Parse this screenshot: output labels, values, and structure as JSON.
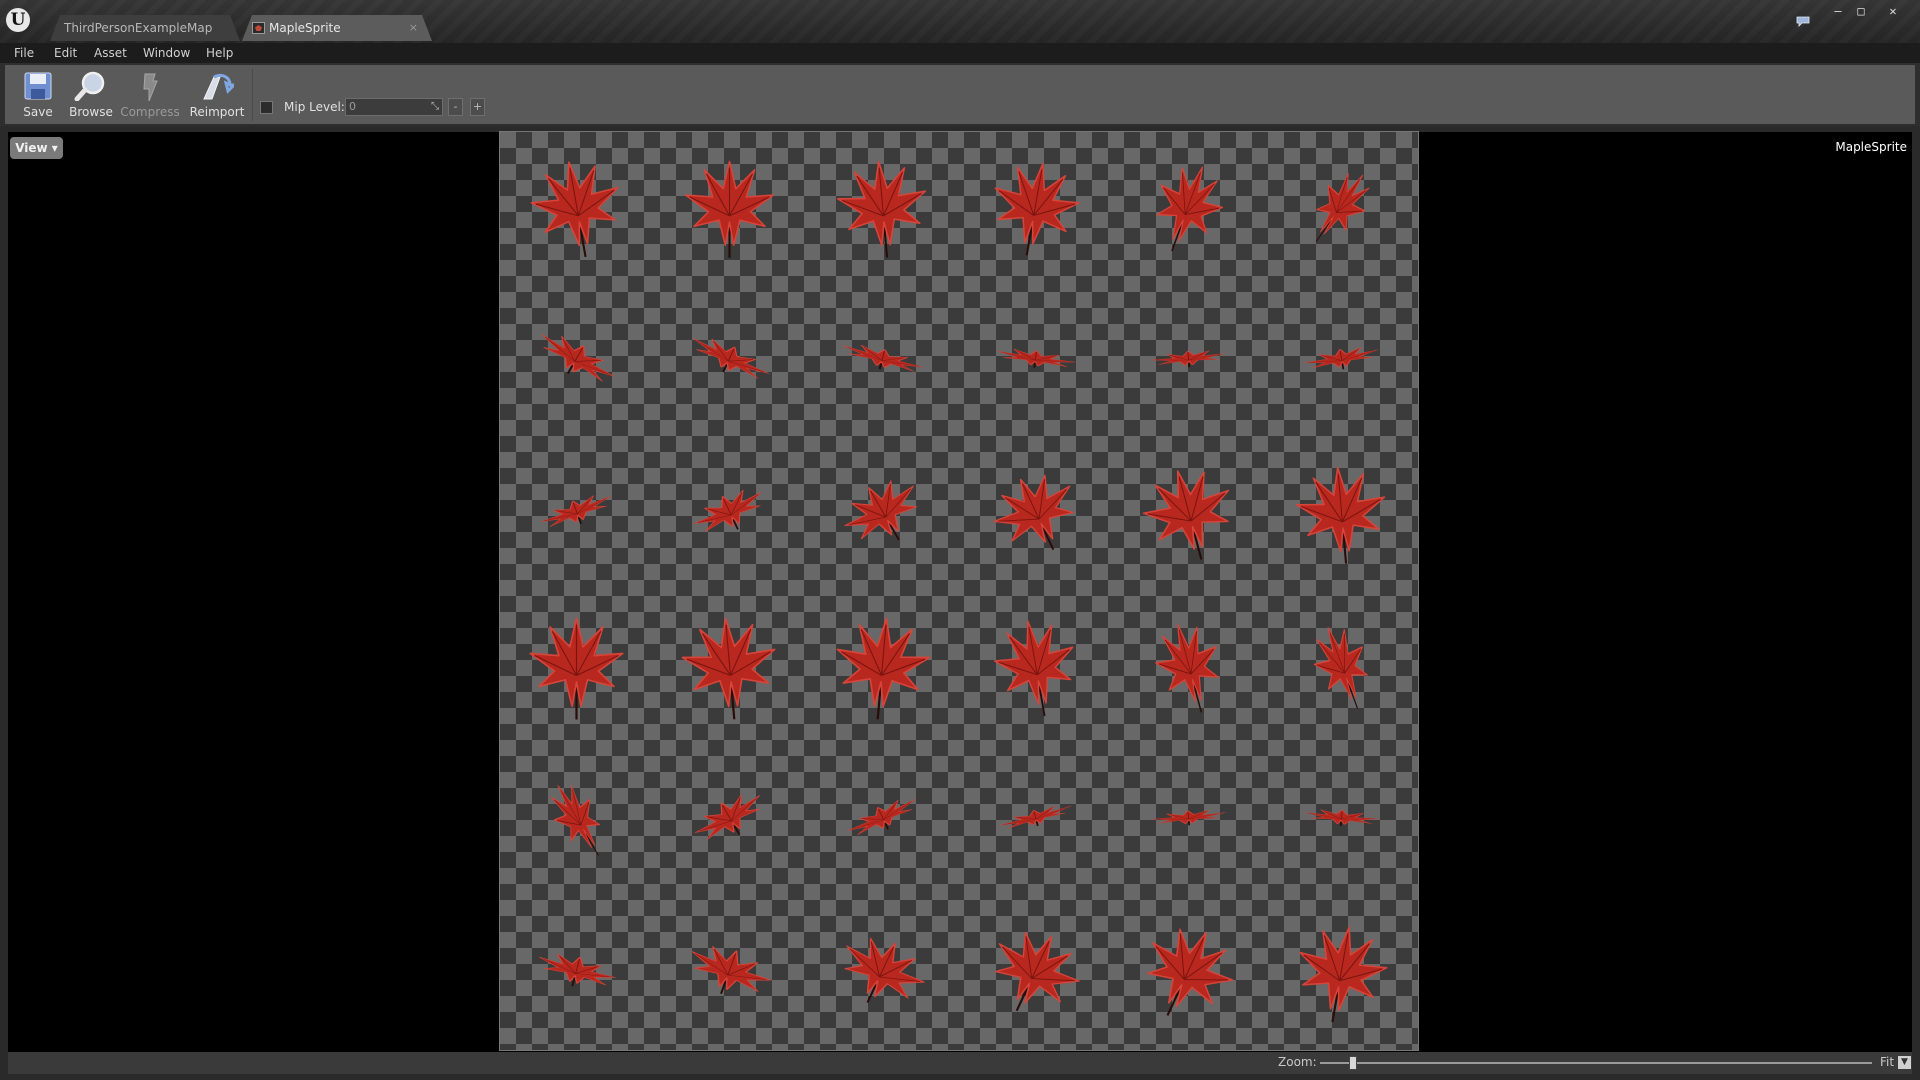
{
  "window": {
    "tabs": [
      {
        "label": "ThirdPersonExampleMap",
        "active": false
      },
      {
        "label": "MapleSprite",
        "active": true,
        "close_glyph": "×"
      }
    ],
    "controls": {
      "minimize": "–",
      "maximize": "□",
      "close": "✕"
    }
  },
  "menu": [
    "File",
    "Edit",
    "Asset",
    "Window",
    "Help"
  ],
  "toolbar": {
    "save_label": "Save",
    "browse_label": "Browse",
    "compress_label": "Compress",
    "reimport_label": "Reimport",
    "mip_level_label": "Mip Level:",
    "mip_level_value": "0",
    "mip_minus": "-",
    "mip_plus": "+"
  },
  "viewport": {
    "view_button": "View ▾",
    "asset_name": "MapleSprite"
  },
  "texture": {
    "description_icons": "maple-leaf-sprite-sheet",
    "rows": 6,
    "cols": 6,
    "leaf_color": "#b8281e",
    "leaf_highlight": "#d6443a"
  },
  "statusbar": {
    "zoom_label": "Zoom:",
    "zoom_mode": "Fit",
    "zoom_fraction": 0.06
  },
  "colors": {
    "viewport_bg": "#000000",
    "checker_light": "#686868",
    "checker_dark": "#3b3b3b"
  }
}
